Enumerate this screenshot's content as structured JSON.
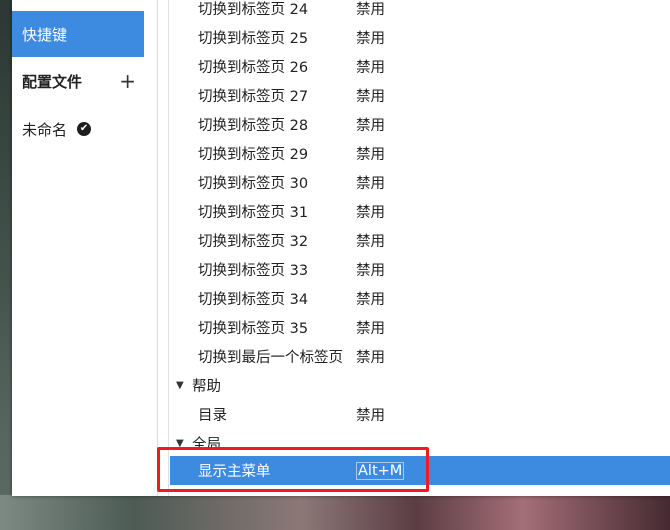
{
  "sidebar": {
    "shortcuts_label": "快捷键",
    "profiles_label": "配置文件",
    "add_label": "+",
    "profile_name": "未命名",
    "profile_check": "✔"
  },
  "rows": {
    "tab24": {
      "name": "切换到标签页 24",
      "value": "禁用"
    },
    "tab25": {
      "name": "切换到标签页 25",
      "value": "禁用"
    },
    "tab26": {
      "name": "切换到标签页 26",
      "value": "禁用"
    },
    "tab27": {
      "name": "切换到标签页 27",
      "value": "禁用"
    },
    "tab28": {
      "name": "切换到标签页 28",
      "value": "禁用"
    },
    "tab29": {
      "name": "切换到标签页 29",
      "value": "禁用"
    },
    "tab30": {
      "name": "切换到标签页 30",
      "value": "禁用"
    },
    "tab31": {
      "name": "切换到标签页 31",
      "value": "禁用"
    },
    "tab32": {
      "name": "切换到标签页 32",
      "value": "禁用"
    },
    "tab33": {
      "name": "切换到标签页 33",
      "value": "禁用"
    },
    "tab34": {
      "name": "切换到标签页 34",
      "value": "禁用"
    },
    "tab35": {
      "name": "切换到标签页 35",
      "value": "禁用"
    },
    "tab_last": {
      "name": "切换到最后一个标签页",
      "value": "禁用"
    },
    "help_group": {
      "name": "帮助",
      "arrow": "▼"
    },
    "contents": {
      "name": "目录",
      "value": "禁用"
    },
    "global_group": {
      "name": "全局",
      "arrow": "▼"
    },
    "show_menu": {
      "name": "显示主菜单",
      "value": "Alt+M"
    }
  },
  "colors": {
    "accent": "#3d8be0",
    "highlight_border": "#ee1b24"
  }
}
